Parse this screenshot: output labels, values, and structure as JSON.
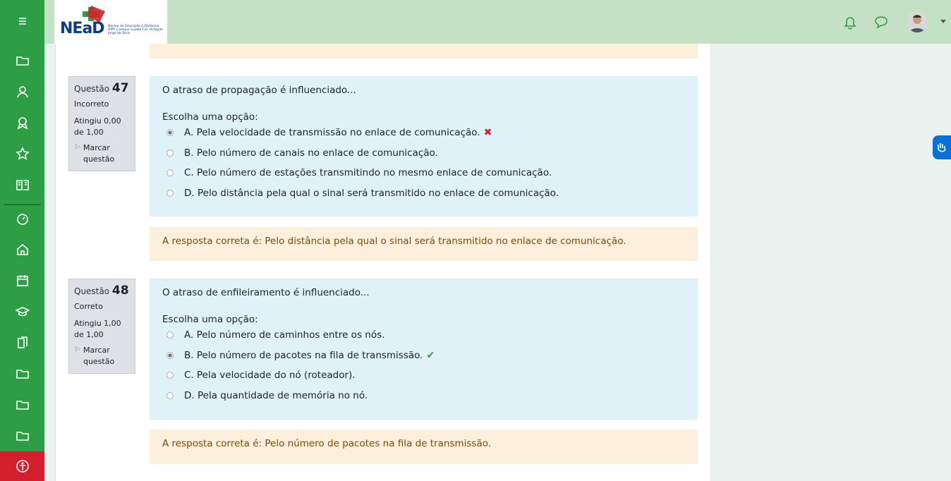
{
  "brand": {
    "logo_text": "NEaD",
    "logo_subtitle": "Núcleo de Educação à Distância IFMT Campus Cuiabá Cel. Octayde Jorge da Silva"
  },
  "sidebar": {
    "icons": [
      "menu-icon",
      "folder-icon",
      "users-icon",
      "badge-icon",
      "star-icon",
      "book-icon",
      "dashboard-icon",
      "home-icon",
      "calendar-icon",
      "graduation-icon",
      "files-icon",
      "folder-icon",
      "folder-icon",
      "folder-icon",
      "accessibility-icon"
    ]
  },
  "questions": [
    {
      "label": "Questão",
      "number": "47",
      "state": "Incorreto",
      "grade": "Atingiu 0,00 de 1,00",
      "flag": "Marcar questão",
      "text": "O atraso de propagação é influenciado...",
      "prompt": "Escolha uma opção:",
      "options": [
        "A. Pela velocidade de transmissão no enlace de comunicação.",
        "B. Pelo número de canais no enlace de comunicação.",
        "C. Pelo número de estações transmitindo no mesmo enlace de comunicação.",
        "D. Pelo distância pela qual o sinal será transmitido no enlace de comunicação."
      ],
      "selected_index": 0,
      "result": "incorrect",
      "feedback": "A resposta correta é: Pelo distância pela qual o sinal será transmitido no enlace de comunicação."
    },
    {
      "label": "Questão",
      "number": "48",
      "state": "Correto",
      "grade": "Atingiu 1,00 de 1,00",
      "flag": "Marcar questão",
      "text": "O atraso de enfileiramento é influenciado...",
      "prompt": "Escolha uma opção:",
      "options": [
        "A. Pelo número de caminhos entre os nós.",
        "B. Pelo número de pacotes na fila de transmissão.",
        "C. Pela velocidade do nó (roteador).",
        "D. Pela quantidade de memória no nó."
      ],
      "selected_index": 1,
      "result": "correct",
      "feedback": "A resposta correta é: Pelo número de pacotes na fila de transmissão."
    }
  ],
  "colors": {
    "sidebar": "#2e9e44",
    "header": "#c5e1c5",
    "question_bg": "#def2f8",
    "feedback_bg": "#fcefdc",
    "incorrect": "#d3202c",
    "correct": "#2e9e44"
  }
}
